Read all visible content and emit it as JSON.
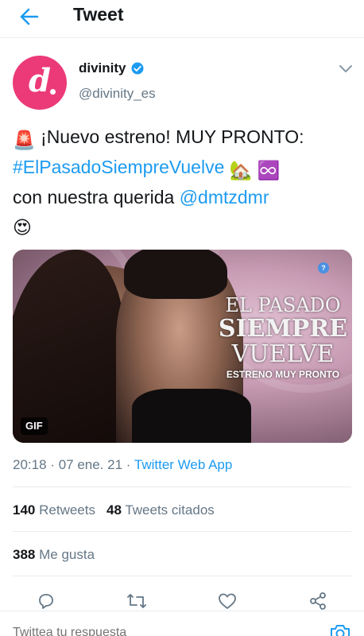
{
  "header": {
    "title": "Tweet",
    "back_icon": "arrow-left-icon"
  },
  "author": {
    "avatar_letter": "d.",
    "avatar_color": "#ec3a78",
    "display_name": "divinity",
    "handle": "@divinity_es",
    "verified": true
  },
  "tweet": {
    "emoji_siren": "🚨",
    "text_part1": "¡Nuevo estreno! MUY PRONTO:",
    "hashtag": "#ElPasadoSiempreVuelve",
    "emoji_house": "🏡",
    "emoji_infinity": "♾️",
    "text_part2": "con nuestra querida",
    "mention": "@dmtzdmr",
    "emoji_hearteyes": "😍"
  },
  "media": {
    "title_line1": "EL PASADO",
    "title_line2": "SIEMPRE",
    "title_line3": "VUELVE",
    "subtitle": "ESTRENO MUY PRONTO",
    "badge": "GIF"
  },
  "meta": {
    "time": "20:18",
    "date": "07 ene. 21",
    "app": "Twitter Web App",
    "sep": "·"
  },
  "stats": {
    "retweets_count": "140",
    "retweets_label": "Retweets",
    "quotes_count": "48",
    "quotes_label": "Tweets citados",
    "likes_count": "388",
    "likes_label": "Me gusta"
  },
  "reply": {
    "placeholder": "Twittea tu respuesta"
  },
  "colors": {
    "accent": "#1d9bf0",
    "muted": "#657786",
    "divider": "#e6ecf0"
  }
}
